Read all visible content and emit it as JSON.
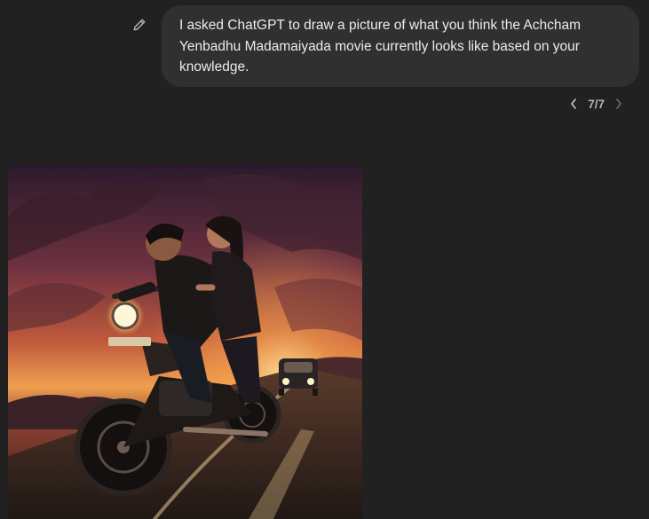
{
  "message": {
    "text": "I asked ChatGPT to draw a picture of what you think the Achcham Yenbadhu Madamaiyada movie currently looks like based on your knowledge."
  },
  "pager": {
    "label": "7/7"
  },
  "icons": {
    "edit": "pencil-icon",
    "prev": "chevron-left-icon",
    "next": "chevron-right-icon"
  },
  "colors": {
    "background": "#212121",
    "bubble": "#303030",
    "text": "#ececec"
  }
}
